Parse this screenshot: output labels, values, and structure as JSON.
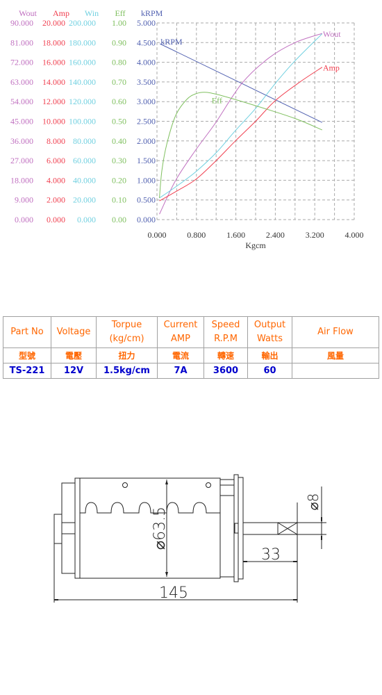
{
  "chart_data": {
    "type": "line",
    "xlabel": "Kgcm",
    "xlim": [
      0,
      4
    ],
    "xticks": [
      "0.000",
      "0.800",
      "1.600",
      "2.400",
      "3.200",
      "4.000"
    ],
    "grid": true,
    "axes": [
      {
        "name": "Wout",
        "color": "#c070c0",
        "max": 90,
        "ticks": [
          "0.000",
          "9.000",
          "18.000",
          "27.000",
          "36.000",
          "45.000",
          "54.000",
          "63.000",
          "72.000",
          "81.000",
          "90.000"
        ]
      },
      {
        "name": "Amp",
        "color": "#f04050",
        "max": 20,
        "ticks": [
          "0.000",
          "2.000",
          "4.000",
          "6.000",
          "8.000",
          "10.000",
          "12.000",
          "14.000",
          "16.000",
          "18.000",
          "20.000"
        ]
      },
      {
        "name": "Win",
        "color": "#70d0e0",
        "max": 200,
        "ticks": [
          "0.000",
          "20.000",
          "40.000",
          "60.000",
          "80.000",
          "100.000",
          "120.000",
          "140.000",
          "160.000",
          "180.000",
          "200.000"
        ]
      },
      {
        "name": "Eff",
        "color": "#80c060",
        "max": 1,
        "ticks": [
          "0.00",
          "0.10",
          "0.20",
          "0.30",
          "0.40",
          "0.50",
          "0.60",
          "0.70",
          "0.80",
          "0.90",
          "1.00"
        ]
      },
      {
        "name": "kRPM",
        "color": "#5060b0",
        "max": 5,
        "ticks": [
          "0.000",
          "0.500",
          "1.000",
          "1.500",
          "2.000",
          "2.500",
          "3.000",
          "3.500",
          "4.000",
          "4.500",
          "5.000"
        ]
      }
    ],
    "series": [
      {
        "name": "kRPM",
        "axis": 4,
        "x": [
          0.06,
          3.35
        ],
        "y": [
          4.47,
          2.47
        ],
        "label": "kRPM",
        "label_at": "start"
      },
      {
        "name": "Wout",
        "axis": 0,
        "x": [
          0.05,
          0.38,
          0.79,
          1.18,
          1.72,
          2.27,
          2.8,
          3.35
        ],
        "y": [
          2.5,
          18,
          32,
          44,
          62.3,
          74,
          81,
          85.2
        ],
        "label": "Wout",
        "label_at": "end"
      },
      {
        "name": "Win",
        "axis": 2,
        "x": [
          0.05,
          0.4,
          0.79,
          1.2,
          1.59,
          2.0,
          2.4,
          2.79,
          3.35
        ],
        "y": [
          22,
          34,
          48.8,
          68,
          90.5,
          113,
          138.5,
          161,
          189
        ],
        "label": "Win",
        "label_at": "none"
      },
      {
        "name": "Amp",
        "axis": 1,
        "x": [
          0.05,
          0.4,
          0.79,
          1.2,
          1.59,
          2.0,
          2.4,
          2.9,
          3.35
        ],
        "y": [
          1.9,
          2.9,
          4.1,
          6.0,
          8.0,
          10.0,
          12.1,
          14.0,
          15.5
        ],
        "label": "Amp",
        "label_at": "end"
      },
      {
        "name": "Eff",
        "axis": 3,
        "x": [
          0.05,
          0.1,
          0.2,
          0.38,
          0.6,
          0.79,
          1.0,
          1.32,
          1.99,
          2.79,
          3.35
        ],
        "y": [
          0.11,
          0.25,
          0.385,
          0.53,
          0.61,
          0.64,
          0.647,
          0.63,
          0.58,
          0.515,
          0.456
        ],
        "label": "Eff",
        "label_at": "middle"
      }
    ]
  },
  "spec_table": {
    "headers": [
      "Part No",
      "Voltage",
      "Torpue (kg/cm)",
      "Current AMP",
      "Speed R.P.M",
      "Output Watts",
      "Air  Flow"
    ],
    "headers_zh": [
      "型號",
      "電壓",
      "扭力",
      "電流",
      "轉速",
      "輸出",
      "風量"
    ],
    "row": [
      "TS-221",
      "12V",
      "1.5kg/cm",
      "7A",
      "3600",
      "60",
      ""
    ]
  },
  "drawing": {
    "diameter_label": "⌀63.5",
    "shaft_diameter_label": "⌀8",
    "shaft_length_label": "33",
    "total_length_label": "145"
  }
}
